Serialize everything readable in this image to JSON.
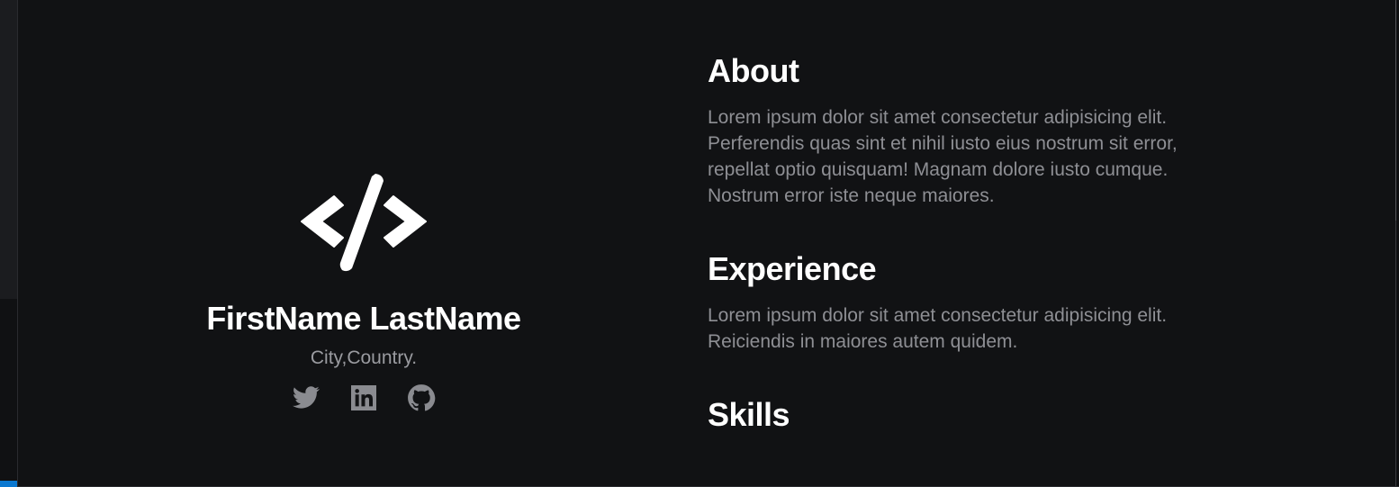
{
  "profile": {
    "logo_icon": "code-slash-icon",
    "name": "FirstName LastName",
    "location": "City,Country.",
    "social": [
      {
        "icon": "twitter-icon",
        "label": "Twitter"
      },
      {
        "icon": "linkedin-icon",
        "label": "LinkedIn"
      },
      {
        "icon": "github-icon",
        "label": "GitHub"
      }
    ]
  },
  "sections": [
    {
      "title": "About",
      "text": "Lorem ipsum dolor sit amet consectetur adipisicing elit. Perferendis quas sint et nihil iusto eius nostrum sit error, repellat optio quisquam! Magnam dolore iusto cumque. Nostrum error iste neque maiores."
    },
    {
      "title": "Experience",
      "text": "Lorem ipsum dolor sit amet consectetur adipisicing elit. Reiciendis in maiores autem quidem."
    },
    {
      "title": "Skills",
      "text": ""
    }
  ],
  "colors": {
    "background": "#111214",
    "heading": "#ffffff",
    "body_text": "#8e8f94",
    "icon_muted": "#8a8b90",
    "accent": "#0b78d0"
  }
}
